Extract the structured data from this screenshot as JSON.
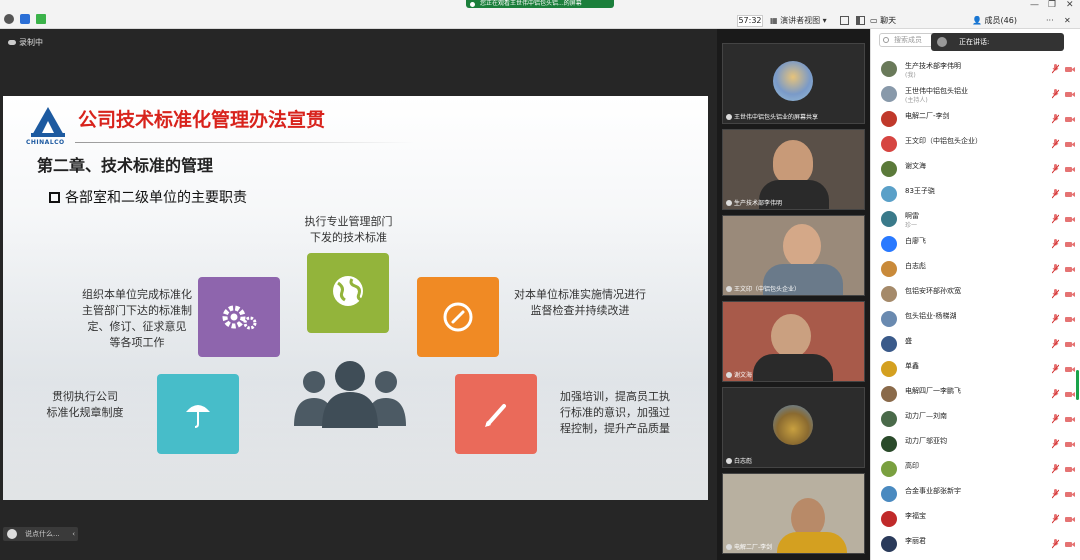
{
  "topbar": {
    "share_banner": "您正在观看王世伟中铝包头铝...的屏幕",
    "timer": "57:32",
    "view_label": "演讲者视图",
    "chat_tab": "聊天",
    "members_tab": "成员(46)",
    "more": "···"
  },
  "main": {
    "recording_label": "录制中",
    "chat_placeholder": "说点什么..."
  },
  "slide": {
    "logo_text": "CHINALCO",
    "title": "公司技术标准化管理办法宣贯",
    "chapter": "第二章、技术标准的管理",
    "subtitle": "各部室和二级单位的主要职责",
    "captions": {
      "top": [
        "执行专业管理部门",
        "下发的技术标准"
      ],
      "left": [
        "组织本单位完成标准化",
        "主管部门下达的标准制",
        "定、修订、征求意见",
        "等各项工作"
      ],
      "right": [
        "对本单位标准实施情况进行",
        "监督检查并持续改进"
      ],
      "bottom_left": [
        "贯彻执行公司",
        "标准化规章制度"
      ],
      "bottom_right": [
        "加强培训，提高员工执",
        "行标准的意识，加强过",
        "程控制，提升产品质量"
      ]
    },
    "colors": {
      "purple": "#8e65ad",
      "green": "#93b43b",
      "orange": "#f08a24",
      "teal": "#47bdc9",
      "red": "#ea6a5a"
    }
  },
  "videos": [
    {
      "name": "王世伟中铝包头铝业的屏幕共享"
    },
    {
      "name": "生产技术部李伟明"
    },
    {
      "name": "王文印（中铝包头企业）"
    },
    {
      "name": "谢文海"
    },
    {
      "name": "白志彪"
    },
    {
      "name": "电解二厂-李剑"
    }
  ],
  "members": {
    "search_placeholder": "搜索成员",
    "speaking_label": "正在讲话:",
    "list": [
      {
        "name": "生产技术部李伟明",
        "role": "(我)",
        "color": "#6a7a5a"
      },
      {
        "name": "王世伟中铝包头铝业",
        "role": "(主持人)",
        "color": "#8899aa"
      },
      {
        "name": "电解二厂-李剑",
        "role": "",
        "color": "#c0392b"
      },
      {
        "name": "王文印（中铝包头企业）",
        "role": "",
        "color": "#d64541"
      },
      {
        "name": "谢文海",
        "role": "",
        "color": "#5b7a3a"
      },
      {
        "name": "83王子骁",
        "role": "",
        "color": "#5aa0c8"
      },
      {
        "name": "啊雷",
        "role": "珍一",
        "color": "#3a7a8a"
      },
      {
        "name": "白廖飞",
        "role": "",
        "color": "#2979ff"
      },
      {
        "name": "白志彪",
        "role": "",
        "color": "#c98a3a"
      },
      {
        "name": "包铝安环部孙欢宽",
        "role": "",
        "color": "#a58a6a"
      },
      {
        "name": "包头铝业-杨梯湖",
        "role": "",
        "color": "#6a8ab0"
      },
      {
        "name": "盛",
        "role": "",
        "color": "#3a5a8a"
      },
      {
        "name": "单鑫",
        "role": "",
        "color": "#d4a020"
      },
      {
        "name": "电解四厂一李鹏飞",
        "role": "",
        "color": "#8a6a4a"
      },
      {
        "name": "动力厂—刘南",
        "role": "",
        "color": "#4a6a4a"
      },
      {
        "name": "动力厂邬亚钧",
        "role": "",
        "color": "#2a4a2a"
      },
      {
        "name": "高印",
        "role": "",
        "color": "#7aa040"
      },
      {
        "name": "合金事业部张新宇",
        "role": "",
        "color": "#4a8ac0"
      },
      {
        "name": "李福宝",
        "role": "",
        "color": "#c02a2a"
      },
      {
        "name": "李丽君",
        "role": "",
        "color": "#2a3a5a"
      }
    ]
  }
}
